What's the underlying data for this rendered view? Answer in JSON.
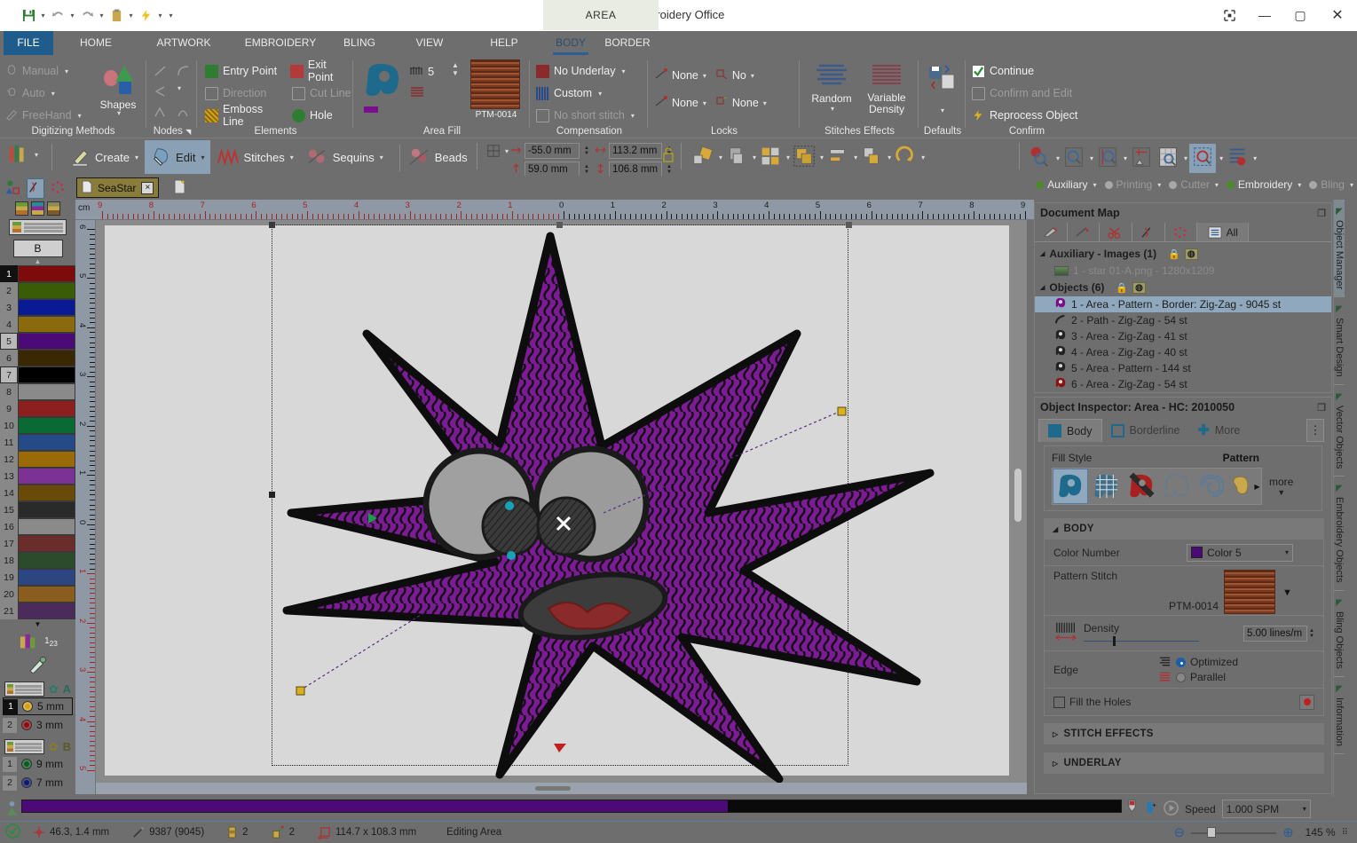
{
  "window": {
    "title": "Embroidery Office",
    "context_tab": "AREA",
    "quick_access": [
      "save-icon",
      "undo-icon",
      "redo-icon",
      "clipboard-icon",
      "lightning-icon",
      "more-icon"
    ],
    "controls": [
      "restore-window-icon",
      "minimize-icon",
      "maximize-icon",
      "close-icon"
    ]
  },
  "ribbon": {
    "tabs": [
      {
        "label": "FILE",
        "state": "file"
      },
      {
        "label": "HOME",
        "state": "normal"
      },
      {
        "label": "ARTWORK",
        "state": "normal"
      },
      {
        "label": "EMBROIDERY",
        "state": "normal"
      },
      {
        "label": "BLING",
        "state": "normal"
      },
      {
        "label": "VIEW",
        "state": "normal"
      },
      {
        "label": "HELP",
        "state": "normal"
      },
      {
        "label": "BODY",
        "state": "active"
      },
      {
        "label": "BORDER",
        "state": "normal"
      }
    ],
    "groups": {
      "digitizing": {
        "title": "Digitizing Methods",
        "items": [
          {
            "label": "Manual",
            "enabled": false,
            "dropdown": true
          },
          {
            "label": "Auto",
            "enabled": false,
            "dropdown": true
          },
          {
            "label": "FreeHand",
            "enabled": false,
            "dropdown": true
          }
        ],
        "shapes_label": "Shapes"
      },
      "nodes": {
        "title": "Nodes"
      },
      "elements": {
        "title": "Elements",
        "items": [
          {
            "label": "Entry Point",
            "enabled": true
          },
          {
            "label": "Exit Point",
            "enabled": true
          },
          {
            "label": "Direction",
            "enabled": false
          },
          {
            "label": "Cut Line",
            "enabled": false
          },
          {
            "label": "Emboss Line",
            "enabled": true
          },
          {
            "label": "Hole",
            "enabled": true
          }
        ]
      },
      "areafill": {
        "title": "Area Fill",
        "stitch_count": "5",
        "pattern_code": "PTM-0014",
        "accent_color": "#7a0f8c"
      },
      "compensation": {
        "title": "Compensation",
        "items": [
          {
            "label": "No Underlay",
            "enabled": true
          },
          {
            "label": "Custom",
            "enabled": true
          },
          {
            "label": "No short stitch",
            "enabled": false
          }
        ]
      },
      "locks": {
        "title": "Locks",
        "items": [
          {
            "label": "None",
            "enabled": true
          },
          {
            "label": "No",
            "enabled": true
          },
          {
            "label": "None",
            "enabled": true
          },
          {
            "label": "None",
            "enabled": true
          }
        ]
      },
      "effects": {
        "title": "Stitches Effects",
        "random_label": "Random",
        "variable_label": "Variable Density"
      },
      "defaults": {
        "title": "Defaults"
      },
      "confirm": {
        "title": "Confirm",
        "items": [
          {
            "label": "Continue",
            "enabled": true
          },
          {
            "label": "Confirm and Edit",
            "enabled": false
          },
          {
            "label": "Reprocess Object",
            "enabled": true
          }
        ]
      }
    }
  },
  "toolbar": {
    "buttons": [
      {
        "label": "Create",
        "icon": "pencil-ruler-icon"
      },
      {
        "label": "Edit",
        "icon": "arrow-node-icon",
        "active": true
      },
      {
        "label": "Stitches",
        "icon": "stitches-icon"
      },
      {
        "label": "Sequins",
        "icon": "sequins-icon"
      },
      {
        "label": "Beads",
        "icon": "beads-icon"
      }
    ],
    "position_x": "-55.0 mm",
    "position_y": "59.0 mm",
    "size_w": "113.2 mm",
    "size_h": "106.8 mm",
    "lock_icon": "lock-aspect-icon",
    "right_icons": [
      "rotate-icon",
      "transparency-icon",
      "align-grid-icon",
      "group-icon",
      "distribute-icon",
      "order-icon",
      "refresh-icon",
      "zoom-object-icon",
      "zoom-page-icon",
      "zoom-height-icon",
      "zoom-width-icon",
      "zoom-grid-icon",
      "zoom-selection-icon",
      "zoom-list-icon"
    ]
  },
  "docbar": {
    "left_icons": [
      "artwork-icon",
      "embroidery-icon",
      "bling-icon"
    ],
    "tab_label": "SeaStar",
    "tab_close": "×",
    "new_tab_icon": "new-document-icon",
    "layers": [
      {
        "label": "Auxiliary",
        "on": true,
        "color": "#4a8a2a"
      },
      {
        "label": "Printing",
        "on": false,
        "color": "#a8a8a8"
      },
      {
        "label": "Cutter",
        "on": false,
        "color": "#a8a8a8"
      },
      {
        "label": "Embroidery",
        "on": true,
        "color": "#4a8a2a"
      },
      {
        "label": "Bling",
        "on": false,
        "color": "#a8a8a8"
      }
    ]
  },
  "palette": {
    "letter_button": "B",
    "colors": [
      {
        "n": "1",
        "hex": "#7d0b0b",
        "sel": true
      },
      {
        "n": "2",
        "hex": "#3b5c06"
      },
      {
        "n": "3",
        "hex": "#081a94"
      },
      {
        "n": "4",
        "hex": "#8a6a0c"
      },
      {
        "n": "5",
        "hex": "#4b0a76",
        "sel": true
      },
      {
        "n": "6",
        "hex": "#3a2805"
      },
      {
        "n": "7",
        "hex": "#000000",
        "sel": true
      },
      {
        "n": "8",
        "hex": "#8a8a8a"
      },
      {
        "n": "9",
        "hex": "#8d1f1f"
      },
      {
        "n": "10",
        "hex": "#0a6a33"
      },
      {
        "n": "11",
        "hex": "#244a88"
      },
      {
        "n": "12",
        "hex": "#9a6a08"
      },
      {
        "n": "13",
        "hex": "#7c3194"
      },
      {
        "n": "14",
        "hex": "#6a4a08"
      },
      {
        "n": "15",
        "hex": "#2a2a2a"
      },
      {
        "n": "16",
        "hex": "#8a8a8a"
      },
      {
        "n": "17",
        "hex": "#6b2c2c"
      },
      {
        "n": "18",
        "hex": "#2c4a2c"
      },
      {
        "n": "19",
        "hex": "#2b4680"
      },
      {
        "n": "20",
        "hex": "#8a5c1e"
      },
      {
        "n": "21",
        "hex": "#4b2a5c"
      }
    ],
    "needle_group_a": "A",
    "needle_group_b": "B",
    "needles_a": [
      {
        "n": "1",
        "size": "5 mm",
        "hex": "#d4a017",
        "active": true
      },
      {
        "n": "2",
        "size": "3 mm",
        "hex": "#8b0f12"
      }
    ],
    "needles_b": [
      {
        "n": "1",
        "size": "9 mm",
        "hex": "#0c5a22"
      },
      {
        "n": "2",
        "size": "7 mm",
        "hex": "#101a6a"
      }
    ]
  },
  "rulers": {
    "unit": "cm",
    "h_ticks": [
      "9",
      "8",
      "7",
      "6",
      "5",
      "4",
      "3",
      "2",
      "1",
      "0",
      "1",
      "2",
      "3",
      "4",
      "5",
      "6",
      "7",
      "8",
      "9"
    ],
    "v_ticks": [
      "6",
      "5",
      "4",
      "3",
      "2",
      "1",
      "0",
      "1",
      "2",
      "3",
      "4",
      "5"
    ]
  },
  "document_map": {
    "title": "Document Map",
    "filter_icons": [
      "pencil-icon",
      "brush-icon",
      "scissors-icon",
      "embroidery-icon",
      "bling-icon"
    ],
    "all_label": "All",
    "groups": [
      {
        "label": "Auxiliary - Images (1)",
        "items": [
          {
            "label": "1 - star 01-A.png - 1280x1209",
            "icon": "image-thumb-icon",
            "dim": true
          }
        ]
      },
      {
        "label": "Objects (6)",
        "items": [
          {
            "label": "1 - Area - Pattern - Border: Zig-Zag - 9045 st",
            "icon": "area-icon",
            "color": "#7a0f8c",
            "selected": true
          },
          {
            "label": "2 - Path - Zig-Zag - 54 st",
            "icon": "path-icon",
            "color": "#222222"
          },
          {
            "label": "3 - Area - Zig-Zag - 41 st",
            "icon": "area-icon",
            "color": "#222222"
          },
          {
            "label": "4 - Area - Zig-Zag - 40 st",
            "icon": "area-icon",
            "color": "#222222"
          },
          {
            "label": "5 - Area - Pattern - 144 st",
            "icon": "area-icon",
            "color": "#222222"
          },
          {
            "label": "6 - Area - Zig-Zag - 54 st",
            "icon": "area-icon",
            "color": "#8b1212"
          }
        ]
      }
    ]
  },
  "inspector": {
    "title": "Object Inspector: Area - HC: 2010050",
    "tabs": [
      {
        "label": "Body",
        "icon": "filled-square-icon",
        "active": true
      },
      {
        "label": "Borderline",
        "icon": "outline-square-icon",
        "active": false
      },
      {
        "label": "More",
        "icon": "plus-icon",
        "active": false
      }
    ],
    "fill_style_label": "Fill Style",
    "fill_style_value": "Pattern",
    "more_label": "more",
    "body_section": "BODY",
    "color_number_label": "Color Number",
    "color_number_value": "Color 5",
    "color_number_hex": "#4b0a76",
    "pattern_stitch_label": "Pattern Stitch",
    "pattern_stitch_code": "PTM-0014",
    "density_label": "Density",
    "density_value": "5.00 lines/m",
    "edge_label": "Edge",
    "edge_options": [
      {
        "label": "Optimized",
        "selected": true
      },
      {
        "label": "Parallel",
        "selected": false
      }
    ],
    "fill_holes_label": "Fill the Holes",
    "fill_holes_checked": false,
    "stitch_effects_section": "STITCH EFFECTS",
    "underlay_section": "UNDERLAY"
  },
  "right_tabs": [
    {
      "label": "Object Manager",
      "active": true
    },
    {
      "label": "Smart Design",
      "active": false
    },
    {
      "label": "Vector Objects",
      "active": false
    },
    {
      "label": "Embroidery Objects",
      "active": false
    },
    {
      "label": "Bling Objects",
      "active": false
    },
    {
      "label": "Information",
      "active": false
    }
  ],
  "statusbar": {
    "coords": "46.3, 1.4 mm",
    "stitches": "9387 (9045)",
    "colors_count": "2",
    "jumps_count": "2",
    "size": "114.7 x 108.3 mm",
    "mode": "Editing Area",
    "speed_label": "Speed",
    "speed_value": "1.000 SPM",
    "zoom_value": "145 %"
  },
  "design": {
    "body_color": "#7d1a96",
    "outline_color": "#101010",
    "eye_color": "#a0a0a0",
    "pupil_color": "#3a3a3a",
    "mouth_color": "#8a2a2a"
  }
}
